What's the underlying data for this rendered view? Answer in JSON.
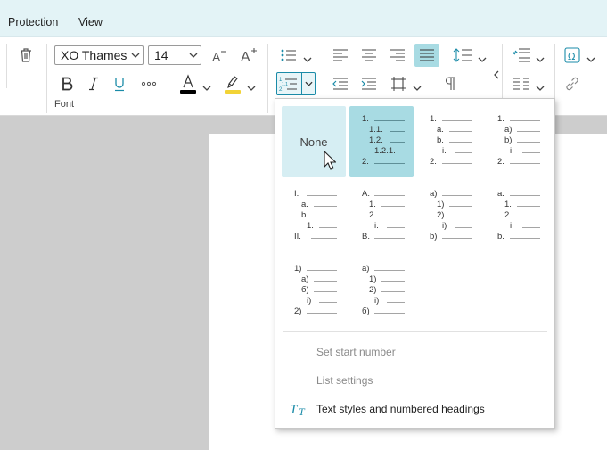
{
  "menubar": {
    "tabs": [
      "Protection",
      "View"
    ]
  },
  "font_group": {
    "font_name": "XO Thames",
    "font_size": "14",
    "label": "Font",
    "font_color": "#000000",
    "highlight_color": "#f2d336"
  },
  "icons": {
    "delete": "trash-icon",
    "grow": "increase-font-size-icon",
    "shrink": "decrease-font-size-icon",
    "bold": "bold-icon",
    "italic": "italic-icon",
    "underline": "underline-icon",
    "more": "more-formatting-icon",
    "bullets": "bulleted-list-icon",
    "numbering": "numbered-list-icon",
    "pilcrow": "pilcrow-icon",
    "special_char": "omega-icon",
    "link": "link-icon"
  },
  "accent_color": "#1a8ba8",
  "numbering_popup": {
    "none_label": "None",
    "styles": [
      {
        "lines": [
          "1.",
          "1.1.",
          "1.2.",
          "1.2.1.",
          "2."
        ]
      },
      {
        "lines": [
          "1.",
          "a.",
          "b.",
          "i.",
          "2."
        ]
      },
      {
        "lines": [
          "1.",
          "a)",
          "b)",
          "i.",
          "2."
        ]
      },
      {
        "lines": [
          "I.",
          "a.",
          "b.",
          "1.",
          "II."
        ]
      },
      {
        "lines": [
          "A.",
          "1.",
          "2.",
          "i.",
          "B."
        ]
      },
      {
        "lines": [
          "a)",
          "1)",
          "2)",
          "i)",
          "b)"
        ]
      },
      {
        "lines": [
          "a.",
          "1.",
          "2.",
          "i.",
          "b."
        ]
      },
      {
        "lines": [
          "1)",
          "a)",
          "б)",
          "i)",
          "2)"
        ]
      },
      {
        "lines": [
          "a)",
          "1)",
          "2)",
          "i)",
          "б)"
        ]
      }
    ],
    "menu_items": {
      "set_start_number": "Set start number",
      "list_settings": "List settings",
      "text_styles": "Text styles and numbered headings"
    }
  }
}
